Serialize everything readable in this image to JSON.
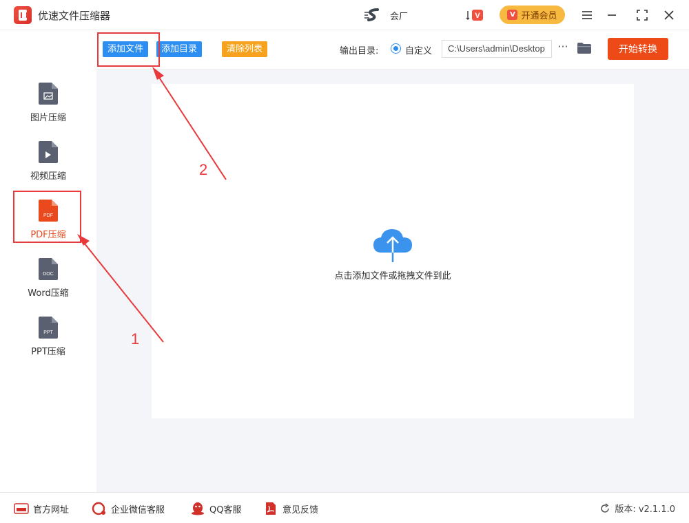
{
  "app": {
    "title": "优速文件压缩器",
    "user_name": "会厂",
    "vip_label": "开通会员",
    "vip_badge": "V"
  },
  "sidebar": {
    "items": [
      {
        "label": "图片压缩",
        "icon": "image-file-icon",
        "badge": ""
      },
      {
        "label": "视频压缩",
        "icon": "video-file-icon",
        "badge": ""
      },
      {
        "label": "PDF压缩",
        "icon": "pdf-file-icon",
        "badge": "PDF",
        "active": true
      },
      {
        "label": "Word压缩",
        "icon": "word-file-icon",
        "badge": "DOC"
      },
      {
        "label": "PPT压缩",
        "icon": "ppt-file-icon",
        "badge": "PPT"
      }
    ]
  },
  "toolbar": {
    "add_file": "添加文件",
    "add_dir": "添加目录",
    "clear_list": "清除列表",
    "output_label": "输出目录:",
    "output_option": "自定义",
    "output_path": "C:\\Users\\admin\\Desktop",
    "more": "···",
    "start": "开始转换"
  },
  "main": {
    "drop_hint": "点击添加文件或拖拽文件到此"
  },
  "annotations": {
    "step1": "1",
    "step2": "2"
  },
  "footer": {
    "website": "官方网址",
    "wechat": "企业微信客服",
    "qq": "QQ客服",
    "feedback": "意见反馈",
    "version": "版本: v2.1.1.0"
  },
  "colors": {
    "primary_blue": "#2b8ef0",
    "accent_orange": "#ee4a17",
    "clear_orange": "#f6a21e",
    "vip_gold": "#f8b940",
    "annotation_red": "#e8393b",
    "sidebar_icon_gray": "#5a6070"
  }
}
